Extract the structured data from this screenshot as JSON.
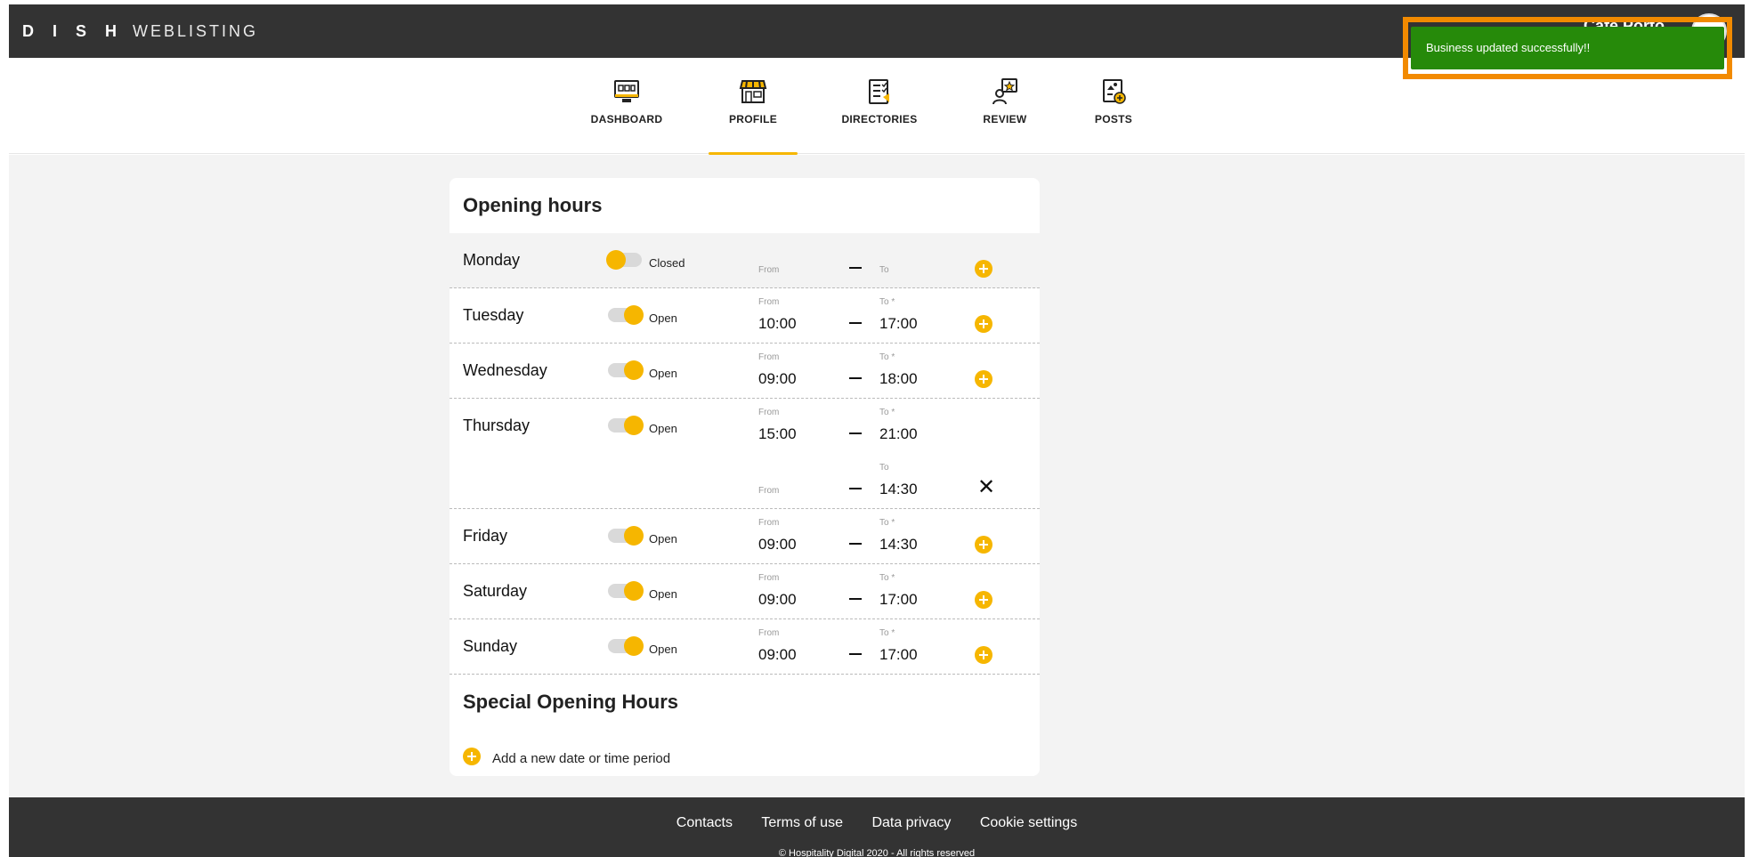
{
  "app": {
    "logo_main": "D I S H",
    "logo_sub": "WEBLISTING",
    "user_name": "Cafe Porto"
  },
  "nav": {
    "items": [
      {
        "label": "DASHBOARD",
        "icon": "monitor-icon"
      },
      {
        "label": "PROFILE",
        "icon": "storefront-icon"
      },
      {
        "label": "DIRECTORIES",
        "icon": "checklist-icon"
      },
      {
        "label": "REVIEW",
        "icon": "star-review-icon"
      },
      {
        "label": "POSTS",
        "icon": "post-icon"
      }
    ],
    "active": "PROFILE"
  },
  "opening_hours": {
    "title": "Opening hours",
    "from_label": "From",
    "to_label": "To",
    "to_required_label": "To *",
    "days": [
      {
        "day": "Monday",
        "state": "Closed",
        "from": "",
        "to": ""
      },
      {
        "day": "Tuesday",
        "state": "Open",
        "from": "10:00",
        "to": "17:00"
      },
      {
        "day": "Wednesday",
        "state": "Open",
        "from": "09:00",
        "to": "18:00"
      },
      {
        "day": "Thursday",
        "state": "Open",
        "from": "15:00",
        "to": "21:00"
      },
      {
        "day": "",
        "state": "",
        "from": "",
        "to": "14:30"
      },
      {
        "day": "Friday",
        "state": "Open",
        "from": "09:00",
        "to": "14:30"
      },
      {
        "day": "Saturday",
        "state": "Open",
        "from": "09:00",
        "to": "17:00"
      },
      {
        "day": "Sunday",
        "state": "Open",
        "from": "09:00",
        "to": "17:00"
      }
    ]
  },
  "special_hours": {
    "title": "Special Opening Hours",
    "add_label": "Add a new date or time period"
  },
  "footer": {
    "links": [
      "Contacts",
      "Terms of use",
      "Data privacy",
      "Cookie settings"
    ],
    "copyright": "© Hospitality Digital 2020 - All rights reserved"
  },
  "toast": {
    "message": "Business updated successfully!!"
  },
  "colors": {
    "accent": "#f6b600",
    "topbar": "#333333",
    "toast_bg": "#268a0a",
    "highlight": "#f28a00"
  }
}
